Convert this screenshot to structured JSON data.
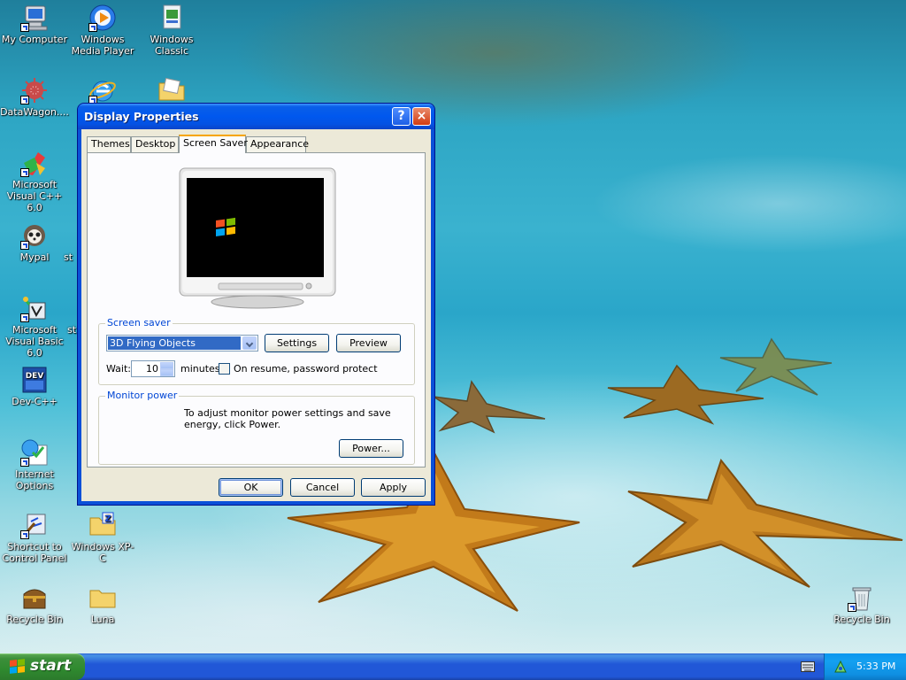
{
  "desktop": {
    "icons": [
      {
        "label": "My Computer",
        "icon": "my-computer-icon"
      },
      {
        "label": "Windows Media Player",
        "icon": "media-player-icon"
      },
      {
        "label": "Windows Classic",
        "icon": "theme-file-icon"
      },
      {
        "label": "DataWagon....",
        "icon": "datawagon-icon"
      },
      {
        "label": "",
        "icon": "internet-explorer-icon"
      },
      {
        "label": "",
        "icon": "folder-icon"
      },
      {
        "label": "Microsoft Visual C++ 6.0",
        "icon": "visual-cpp-icon"
      },
      {
        "label": "Mypal",
        "icon": "mypal-browser-icon"
      },
      {
        "label": "st",
        "icon": ""
      },
      {
        "label": "Microsoft Visual Basic 6.0",
        "icon": "visual-basic-icon"
      },
      {
        "label": "st",
        "icon": ""
      },
      {
        "label": "Dev-C++",
        "icon": "dev-cpp-icon"
      },
      {
        "label": "Internet Options",
        "icon": "internet-options-icon"
      },
      {
        "label": "Shortcut to Control Panel",
        "icon": "control-panel-icon"
      },
      {
        "label": "Windows XP-C",
        "icon": "zip-folder-icon"
      },
      {
        "label": "Recycle Bin",
        "icon": "treasure-chest-icon"
      },
      {
        "label": "Luna",
        "icon": "folder-icon"
      },
      {
        "label": "Recycle Bin",
        "icon": "recycle-bin-icon"
      }
    ]
  },
  "dialog": {
    "title": "Display Properties",
    "help_button": "?",
    "close_button": "×",
    "tabs": [
      "Themes",
      "Desktop",
      "Screen Saver",
      "Appearance"
    ],
    "active_tab": "Screen Saver",
    "screen_saver": {
      "group_label": "Screen saver",
      "selected": "3D Flying Objects",
      "settings_button": "Settings",
      "preview_button": "Preview",
      "wait_label": "Wait:",
      "wait_value": "10",
      "minutes_label": "minutes",
      "password_label": "On resume, password protect"
    },
    "monitor_power": {
      "group_label": "Monitor power",
      "description": "To adjust monitor power settings and save energy, click Power.",
      "power_button": "Power..."
    },
    "buttons": {
      "ok": "OK",
      "cancel": "Cancel",
      "apply": "Apply"
    }
  },
  "taskbar": {
    "start_label": "start",
    "clock": "5:33 PM"
  },
  "colors": {
    "titlebar": "#0058ee",
    "dialog_face": "#ece9d8",
    "group_label": "#0046d5",
    "start_green": "#2f8a2f",
    "taskbar_blue": "#2157d7",
    "tray_blue": "#0f8fe2"
  }
}
